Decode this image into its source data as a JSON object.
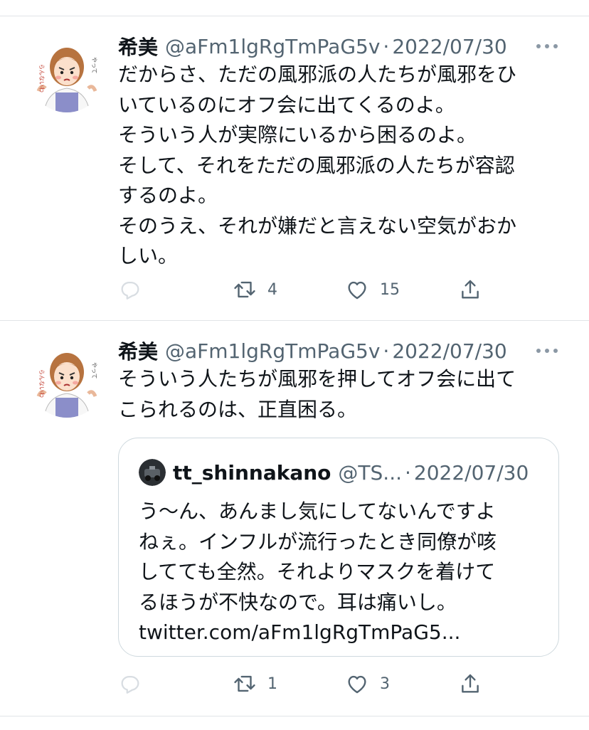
{
  "tweets": [
    {
      "name": "希美",
      "handle": "@aFm1lgRgTmPaG5v",
      "separator": "·",
      "date": "2022/07/30",
      "avatar_text_left": "らんないわ",
      "avatar_text_right": "やって",
      "lines": [
        "だからさ、ただの風邪派の人たちが風邪をひ",
        "いているのにオフ会に出てくるのよ。",
        "そういう人が実際にいるから困るのよ。",
        "そして、それをただの風邪派の人たちが容認",
        "するのよ。",
        "そのうえ、それが嫌だと言えない空気がおか",
        "しい。"
      ],
      "actions": {
        "retweets": "4",
        "likes": "15"
      }
    },
    {
      "name": "希美",
      "handle": "@aFm1lgRgTmPaG5v",
      "separator": "·",
      "date": "2022/07/30",
      "avatar_text_left": "らんないわ",
      "avatar_text_right": "やって",
      "lines": [
        "そういう人たちが風邪を押してオフ会に出て",
        "こられるのは、正直困る。"
      ],
      "quote": {
        "name": "tt_shinnakano",
        "handle": "@TS...",
        "separator": "·",
        "date": "2022/07/30",
        "lines": [
          "う〜ん、あんまし気にしてないんですよ",
          "ねぇ。インフルが流行ったとき同僚が咳",
          "してても全然。それよりマスクを着けて",
          "るほうが不快なので。耳は痛いし。",
          "twitter.com/aFm1lgRgTmPaG5..."
        ]
      },
      "actions": {
        "retweets": "1",
        "likes": "3"
      }
    }
  ],
  "icons": [
    "reply-icon",
    "retweet-icon",
    "like-icon",
    "share-icon",
    "more-icon"
  ],
  "colors": {
    "text": "#0f1419",
    "secondary": "#536471",
    "icon": "#536471",
    "divider": "#e1e4e7",
    "quote_border": "#cfd9de"
  }
}
